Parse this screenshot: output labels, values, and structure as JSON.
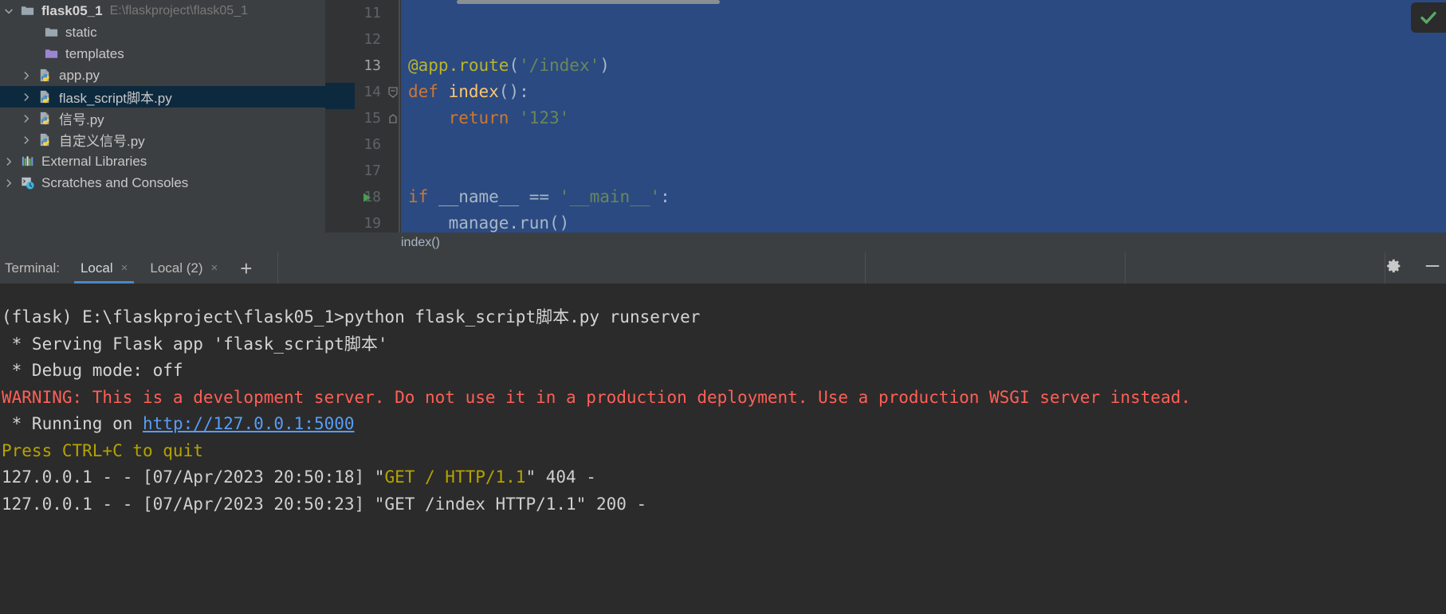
{
  "project_tree": {
    "items": [
      {
        "label": "flask05_1",
        "path": "E:\\flaskproject\\flask05_1",
        "icon": "folder-icon",
        "arrow": "chevron-down-icon",
        "name": "tree-item-flask05-1"
      },
      {
        "label": "static",
        "path": "",
        "icon": "folder-icon",
        "arrow": "",
        "name": "tree-item-static"
      },
      {
        "label": "templates",
        "path": "",
        "icon": "folder-purple-icon",
        "arrow": "",
        "name": "tree-item-templates"
      },
      {
        "label": "app.py",
        "path": "",
        "icon": "python-file-icon",
        "arrow": "chevron-right-icon",
        "name": "tree-item-app-py"
      },
      {
        "label": "flask_script脚本.py",
        "path": "",
        "icon": "python-file-icon",
        "arrow": "chevron-right-icon",
        "name": "tree-item-flask-script-py"
      },
      {
        "label": "信号.py",
        "path": "",
        "icon": "python-file-icon",
        "arrow": "chevron-right-icon",
        "name": "tree-item-xinhao-py"
      },
      {
        "label": "自定义信号.py",
        "path": "",
        "icon": "python-file-icon",
        "arrow": "chevron-right-icon",
        "name": "tree-item-zidingyi-xinhao-py"
      },
      {
        "label": "External Libraries",
        "path": "",
        "icon": "libraries-icon",
        "arrow": "chevron-right-icon",
        "name": "tree-item-external-libraries"
      },
      {
        "label": "Scratches and Consoles",
        "path": "",
        "icon": "scratches-icon",
        "arrow": "chevron-right-icon",
        "name": "tree-item-scratches-and-consoles"
      }
    ],
    "selected_index": 4
  },
  "editor": {
    "lines": [
      {
        "no": "11",
        "tokens": []
      },
      {
        "no": "12",
        "tokens": []
      },
      {
        "no": "13",
        "tokens": [
          {
            "t": "@app.route",
            "c": "tok-dec"
          },
          {
            "t": "(",
            "c": "tok-punc"
          },
          {
            "t": "'/index'",
            "c": "tok-str"
          },
          {
            "t": ")",
            "c": "tok-punc"
          }
        ]
      },
      {
        "no": "14",
        "fold": "minus",
        "tokens": [
          {
            "t": "def ",
            "c": "tok-kw"
          },
          {
            "t": "index",
            "c": "tok-fn"
          },
          {
            "t": "():",
            "c": "tok-punc"
          }
        ]
      },
      {
        "no": "15",
        "fold": "end",
        "tokens": [
          {
            "t": "    ",
            "c": "tok-plain"
          },
          {
            "t": "return ",
            "c": "tok-kw"
          },
          {
            "t": "'123'",
            "c": "tok-str"
          }
        ]
      },
      {
        "no": "16",
        "tokens": []
      },
      {
        "no": "17",
        "tokens": []
      },
      {
        "no": "18",
        "run": true,
        "tokens": [
          {
            "t": "if ",
            "c": "tok-kw"
          },
          {
            "t": "__name__ ",
            "c": "tok-plain"
          },
          {
            "t": "== ",
            "c": "tok-plain"
          },
          {
            "t": "'__main__'",
            "c": "tok-str"
          },
          {
            "t": ":",
            "c": "tok-punc"
          }
        ]
      },
      {
        "no": "19",
        "tokens": [
          {
            "t": "    manage.run()",
            "c": "tok-plain"
          }
        ]
      }
    ],
    "active_line": "13",
    "breadcrumb": "index()",
    "status_icon": "checkmark-ok-icon"
  },
  "terminal": {
    "label": "Terminal:",
    "tabs": [
      {
        "label": "Local",
        "close": "×",
        "active": true,
        "name": "terminal-tab-local"
      },
      {
        "label": "Local (2)",
        "close": "×",
        "active": false,
        "name": "terminal-tab-local-2"
      }
    ],
    "add_label": "+",
    "settings_icon": "gear-icon",
    "minimize_icon": "minimize-icon",
    "output": [
      {
        "name": "terminal-line-command",
        "parts": [
          {
            "t": "(flask) E:\\flaskproject\\flask05_1>python flask_script脚本.py runserver",
            "c": "t-white"
          }
        ]
      },
      {
        "name": "terminal-line-serving",
        "parts": [
          {
            "t": " * Serving Flask app 'flask_script脚本'",
            "c": "t-white"
          }
        ]
      },
      {
        "name": "terminal-line-debug-mode",
        "parts": [
          {
            "t": " * Debug mode: off",
            "c": "t-white"
          }
        ]
      },
      {
        "name": "terminal-line-warning",
        "parts": [
          {
            "t": "WARNING: This is a development server. Do not use it in a production deployment. Use a production WSGI server instead.",
            "c": "t-red"
          }
        ]
      },
      {
        "name": "terminal-line-running-on",
        "parts": [
          {
            "t": " * Running on ",
            "c": "t-white"
          },
          {
            "t": "http://127.0.0.1:5000",
            "c": "t-link"
          }
        ]
      },
      {
        "name": "terminal-line-press-ctrl-c",
        "parts": [
          {
            "t": "Press CTRL+C to quit",
            "c": "t-yellow"
          }
        ]
      },
      {
        "name": "terminal-line-log-404",
        "parts": [
          {
            "t": "127.0.0.1 - - [07/Apr/2023 20:50:18] \"",
            "c": "t-grey"
          },
          {
            "t": "GET / HTTP/1.1",
            "c": "t-yellow"
          },
          {
            "t": "\" 404 -",
            "c": "t-grey"
          }
        ]
      },
      {
        "name": "terminal-line-log-200",
        "parts": [
          {
            "t": "127.0.0.1 - - [07/Apr/2023 20:50:23] \"GET /index HTTP/1.1\" 200 -",
            "c": "t-grey"
          }
        ]
      }
    ]
  },
  "colors": {
    "editor_selection": "#2b4a82",
    "tree_selection": "#0d293e",
    "warning_red": "#ff5f56",
    "link_blue": "#589df6",
    "prompt_yellow": "#b5a300",
    "accent_tab": "#4a88c7"
  }
}
